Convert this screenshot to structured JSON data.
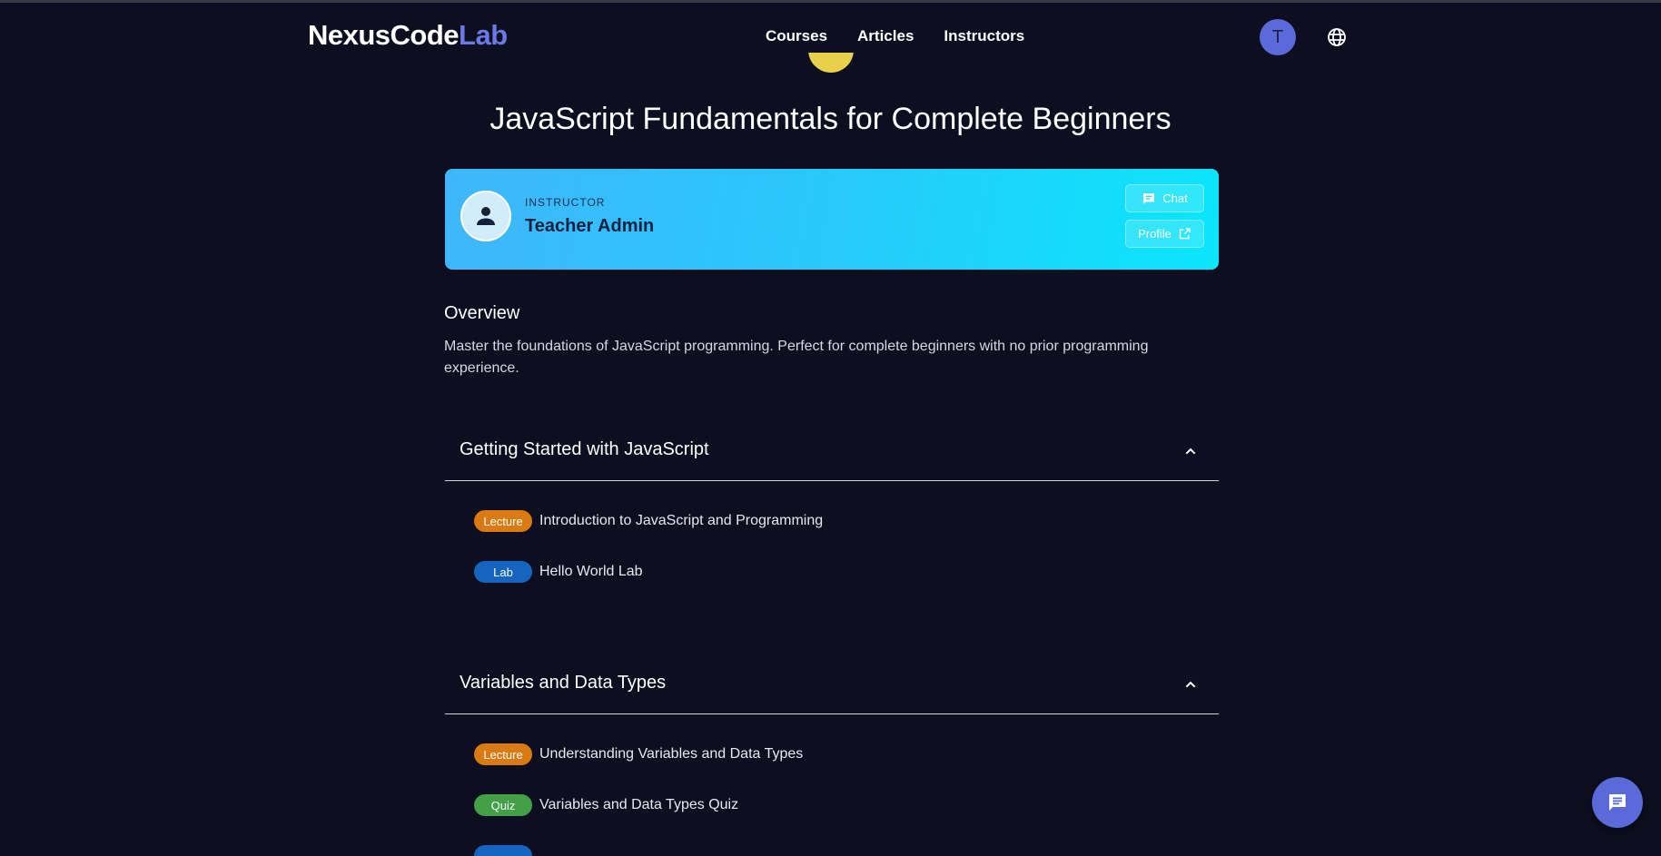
{
  "header": {
    "logo_main": "NexusCode",
    "logo_accent": "Lab",
    "nav": [
      "Courses",
      "Articles",
      "Instructors"
    ],
    "user_initial": "T",
    "globe_icon": "globe-icon"
  },
  "course": {
    "title": "JavaScript Fundamentals for Complete Beginners"
  },
  "instructor": {
    "label": "INSTRUCTOR",
    "name": "Teacher Admin",
    "chat_label": "Chat",
    "profile_label": "Profile"
  },
  "overview": {
    "heading": "Overview",
    "text": "Master the foundations of JavaScript programming. Perfect for complete beginners with no prior programming experience."
  },
  "sections": [
    {
      "title": "Getting Started with JavaScript",
      "lessons": [
        {
          "type": "Lecture",
          "title": "Introduction to JavaScript and Programming"
        },
        {
          "type": "Lab",
          "title": "Hello World Lab"
        }
      ]
    },
    {
      "title": "Variables and Data Types",
      "lessons": [
        {
          "type": "Lecture",
          "title": "Understanding Variables and Data Types"
        },
        {
          "type": "Quiz",
          "title": "Variables and Data Types Quiz"
        }
      ]
    }
  ],
  "colors": {
    "background": "#0d0e1f",
    "accent": "#5a6ad8",
    "lecture_badge": "#d97a12",
    "lab_badge": "#1565c0",
    "quiz_badge": "#43a047"
  }
}
